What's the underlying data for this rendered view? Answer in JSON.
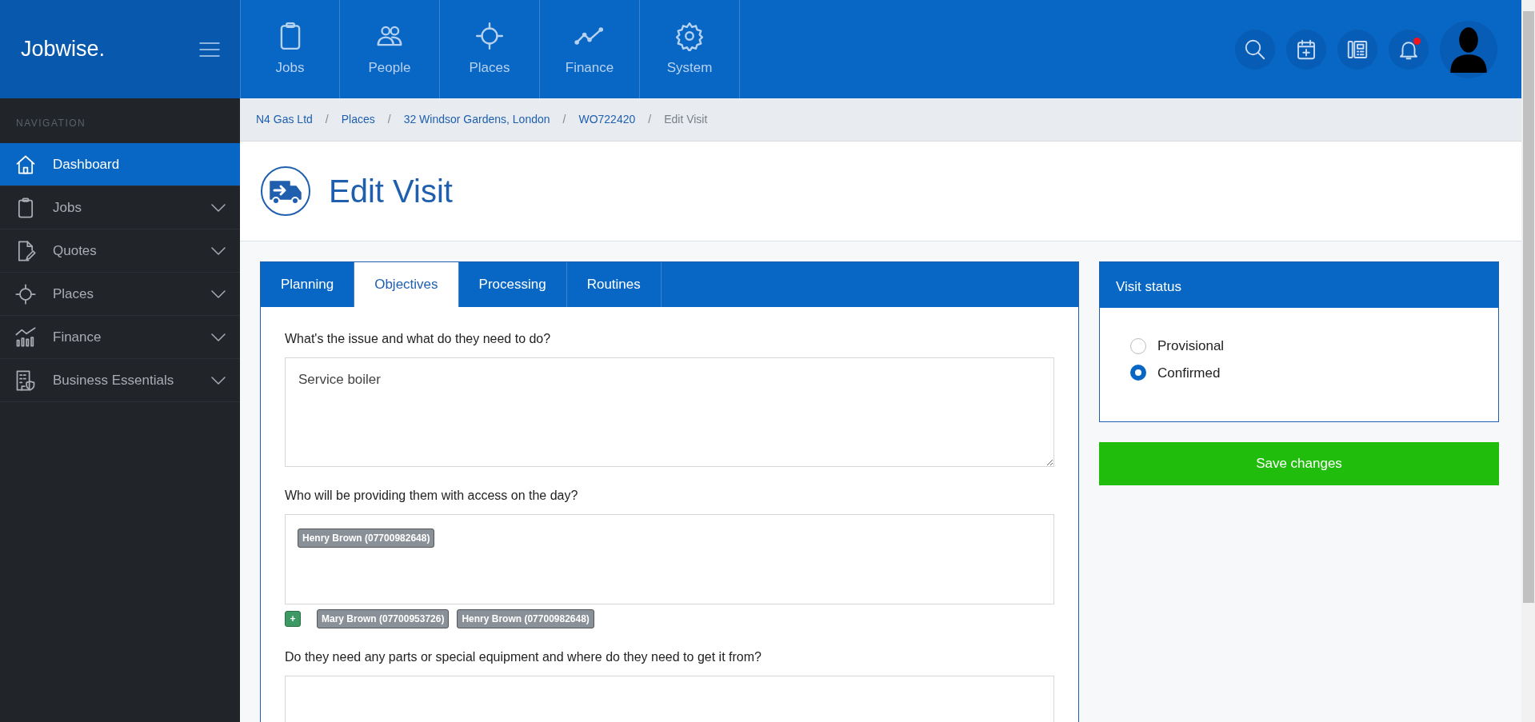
{
  "brand": "Jobwise.",
  "top_nav": [
    {
      "label": "Jobs"
    },
    {
      "label": "People"
    },
    {
      "label": "Places"
    },
    {
      "label": "Finance"
    },
    {
      "label": "System"
    }
  ],
  "notifications": {
    "unread": true
  },
  "sidebar": {
    "heading": "NAVIGATION",
    "items": [
      {
        "label": "Dashboard",
        "selected": true,
        "expandable": false
      },
      {
        "label": "Jobs",
        "selected": false,
        "expandable": true
      },
      {
        "label": "Quotes",
        "selected": false,
        "expandable": true
      },
      {
        "label": "Places",
        "selected": false,
        "expandable": true
      },
      {
        "label": "Finance",
        "selected": false,
        "expandable": true
      },
      {
        "label": "Business Essentials",
        "selected": false,
        "expandable": true
      }
    ]
  },
  "breadcrumb": [
    {
      "label": "N4 Gas Ltd",
      "current": false
    },
    {
      "separator": "/",
      "label": "Places",
      "current": false
    },
    {
      "separator": "/",
      "label": "32 Windsor Gardens, London",
      "current": false
    },
    {
      "separator": "/",
      "label": "WO722420",
      "current": false
    },
    {
      "separator": "/",
      "label": "Edit Visit",
      "current": true
    }
  ],
  "page_title": "Edit Visit",
  "tabs": [
    {
      "label": "Planning",
      "selected": false
    },
    {
      "label": "Objectives",
      "selected": true
    },
    {
      "label": "Processing",
      "selected": false
    },
    {
      "label": "Routines",
      "selected": false
    }
  ],
  "fields": [
    {
      "kind": "textarea",
      "label": "What's the issue and what do they need to do?",
      "value": "Service boiler"
    },
    {
      "kind": "tags",
      "label": "Who will be providing them with access on the day?",
      "tags": [
        "Henry Brown (07700982648)"
      ],
      "add_button": "+",
      "suggestions": [
        "Mary Brown (07700953726)",
        "Henry Brown (07700982648)"
      ]
    },
    {
      "kind": "textarea",
      "label": "Do they need any parts or special equipment and where do they need to get it from?"
    }
  ],
  "status_panel": {
    "title": "Visit status",
    "options": [
      {
        "label": "Provisional",
        "selected": false
      },
      {
        "label": "Confirmed",
        "selected": true
      }
    ]
  },
  "save_button": "Save changes"
}
